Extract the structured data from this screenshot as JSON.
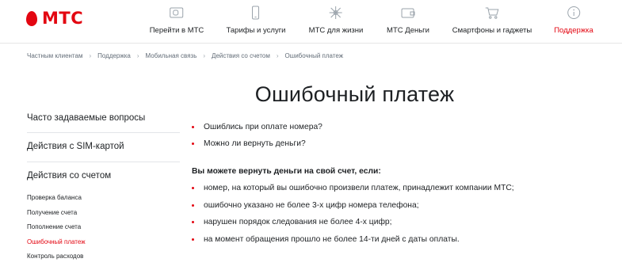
{
  "header": {
    "logo_text": "МТС",
    "nav": [
      {
        "label": "Перейти в МТС",
        "icon": "sim-card-icon"
      },
      {
        "label": "Тарифы и услуги",
        "icon": "smartphone-icon"
      },
      {
        "label": "МТС для жизни",
        "icon": "sparkle-icon"
      },
      {
        "label": "МТС Деньги",
        "icon": "wallet-icon"
      },
      {
        "label": "Смартфоны и гаджеты",
        "icon": "shopping-cart-icon"
      },
      {
        "label": "Поддержка",
        "icon": "info-icon",
        "active": true
      }
    ]
  },
  "breadcrumb": [
    "Частным клиентам",
    "Поддержка",
    "Мобильная связь",
    "Действия со счетом",
    "Ошибочный платеж"
  ],
  "page_title": "Ошибочный платеж",
  "sidebar": {
    "sections": [
      "Часто задаваемые вопросы",
      "Действия с SIM-картой",
      "Действия со счетом"
    ],
    "sub_items": [
      "Проверка баланса",
      "Получение счета",
      "Пополнение счета",
      "Ошибочный платеж",
      "Контроль расходов"
    ],
    "active_sub_index": 3
  },
  "content": {
    "questions": [
      "Ошиблись при оплате номера?",
      "Можно ли вернуть деньги?"
    ],
    "conditions_heading": "Вы можете вернуть деньги на свой счет, если:",
    "conditions": [
      "номер, на который вы ошибочно произвели платеж, принадлежит компании МТС;",
      "ошибочно указано не более 3-х цифр номера телефона;",
      "нарушен порядок следования не более 4-х цифр;",
      "на момент обращения прошло не более 14-ти дней с даты оплаты."
    ]
  },
  "colors": {
    "brand_red": "#e30611",
    "text": "#1d2023",
    "muted": "#626c77",
    "divider": "#e2e5e9"
  }
}
